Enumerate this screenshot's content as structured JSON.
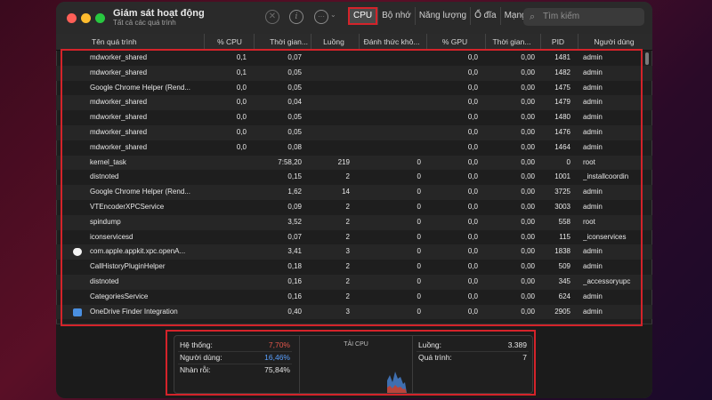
{
  "window": {
    "title": "Giám sát hoạt động",
    "subtitle": "Tất cả các quá trình"
  },
  "toolbar": {
    "stop_icon": "stop-icon",
    "info_icon": "info-icon",
    "more_icon": "more-icon",
    "tabs": [
      "CPU",
      "Bộ nhớ",
      "Năng lượng",
      "Ổ đĩa",
      "Mạng"
    ],
    "active_tab": "CPU",
    "search_placeholder": "Tìm kiếm"
  },
  "columns": [
    "Tên quá trình",
    "% CPU",
    "Thời gian...",
    "Luồng",
    "Đánh thức khô...",
    "% GPU",
    "Thời gian...",
    "PID",
    "Người dùng"
  ],
  "rows": [
    {
      "name": "mdworker_shared",
      "cpu": "0,1",
      "time": "0,07",
      "threads": "",
      "wakeups": "",
      "gpu": "0,0",
      "gputime": "0,00",
      "pid": "1481",
      "user": "admin",
      "icon": ""
    },
    {
      "name": "mdworker_shared",
      "cpu": "0,1",
      "time": "0,05",
      "threads": "",
      "wakeups": "",
      "gpu": "0,0",
      "gputime": "0,00",
      "pid": "1482",
      "user": "admin",
      "icon": ""
    },
    {
      "name": "Google Chrome Helper (Rend...",
      "cpu": "0,0",
      "time": "0,05",
      "threads": "",
      "wakeups": "",
      "gpu": "0,0",
      "gputime": "0,00",
      "pid": "1475",
      "user": "admin",
      "icon": ""
    },
    {
      "name": "mdworker_shared",
      "cpu": "0,0",
      "time": "0,04",
      "threads": "",
      "wakeups": "",
      "gpu": "0,0",
      "gputime": "0,00",
      "pid": "1479",
      "user": "admin",
      "icon": ""
    },
    {
      "name": "mdworker_shared",
      "cpu": "0,0",
      "time": "0,05",
      "threads": "",
      "wakeups": "",
      "gpu": "0,0",
      "gputime": "0,00",
      "pid": "1480",
      "user": "admin",
      "icon": ""
    },
    {
      "name": "mdworker_shared",
      "cpu": "0,0",
      "time": "0,05",
      "threads": "",
      "wakeups": "",
      "gpu": "0,0",
      "gputime": "0,00",
      "pid": "1476",
      "user": "admin",
      "icon": ""
    },
    {
      "name": "mdworker_shared",
      "cpu": "0,0",
      "time": "0,08",
      "threads": "",
      "wakeups": "",
      "gpu": "0,0",
      "gputime": "0,00",
      "pid": "1464",
      "user": "admin",
      "icon": ""
    },
    {
      "name": "kernel_task",
      "cpu": "",
      "time": "7:58,20",
      "threads": "219",
      "wakeups": "0",
      "gpu": "0,0",
      "gputime": "0,00",
      "pid": "0",
      "user": "root",
      "icon": ""
    },
    {
      "name": "distnoted",
      "cpu": "",
      "time": "0,15",
      "threads": "2",
      "wakeups": "0",
      "gpu": "0,0",
      "gputime": "0,00",
      "pid": "1001",
      "user": "_installcoordin",
      "icon": ""
    },
    {
      "name": "Google Chrome Helper (Rend...",
      "cpu": "",
      "time": "1,62",
      "threads": "14",
      "wakeups": "0",
      "gpu": "0,0",
      "gputime": "0,00",
      "pid": "3725",
      "user": "admin",
      "icon": ""
    },
    {
      "name": "VTEncoderXPCService",
      "cpu": "",
      "time": "0,09",
      "threads": "2",
      "wakeups": "0",
      "gpu": "0,0",
      "gputime": "0,00",
      "pid": "3003",
      "user": "admin",
      "icon": ""
    },
    {
      "name": "spindump",
      "cpu": "",
      "time": "3,52",
      "threads": "2",
      "wakeups": "0",
      "gpu": "0,0",
      "gputime": "0,00",
      "pid": "558",
      "user": "root",
      "icon": ""
    },
    {
      "name": "iconservicesd",
      "cpu": "",
      "time": "0,07",
      "threads": "2",
      "wakeups": "0",
      "gpu": "0,0",
      "gputime": "0,00",
      "pid": "115",
      "user": "_iconservices",
      "icon": ""
    },
    {
      "name": "com.apple.appkit.xpc.openA...",
      "cpu": "",
      "time": "3,41",
      "threads": "3",
      "wakeups": "0",
      "gpu": "0,0",
      "gputime": "0,00",
      "pid": "1838",
      "user": "admin",
      "icon": "shield-icon"
    },
    {
      "name": "CallHistoryPluginHelper",
      "cpu": "",
      "time": "0,18",
      "threads": "2",
      "wakeups": "0",
      "gpu": "0,0",
      "gputime": "0,00",
      "pid": "509",
      "user": "admin",
      "icon": ""
    },
    {
      "name": "distnoted",
      "cpu": "",
      "time": "0,16",
      "threads": "2",
      "wakeups": "0",
      "gpu": "0,0",
      "gputime": "0,00",
      "pid": "345",
      "user": "_accessoryupc",
      "icon": ""
    },
    {
      "name": "CategoriesService",
      "cpu": "",
      "time": "0,16",
      "threads": "2",
      "wakeups": "0",
      "gpu": "0,0",
      "gputime": "0,00",
      "pid": "624",
      "user": "admin",
      "icon": ""
    },
    {
      "name": "OneDrive Finder Integration",
      "cpu": "",
      "time": "0,40",
      "threads": "3",
      "wakeups": "0",
      "gpu": "0,0",
      "gputime": "0,00",
      "pid": "2905",
      "user": "admin",
      "icon": "onedrive-icon"
    }
  ],
  "summary": {
    "system_label": "Hệ thống:",
    "system_value": "7,70%",
    "user_label": "Người dùng:",
    "user_value": "16,46%",
    "idle_label": "Nhàn rỗi:",
    "idle_value": "75,84%",
    "load_title": "TẢI CPU",
    "load_system_fraction": 0.077,
    "load_user_fraction": 0.1646,
    "threads_label": "Luồng:",
    "threads_value": "3.389",
    "processes_label": "Quá trình:",
    "processes_value": "7"
  },
  "colors": {
    "highlight": "#d4232a",
    "system": "#e4574b",
    "user": "#5aa0ff"
  }
}
